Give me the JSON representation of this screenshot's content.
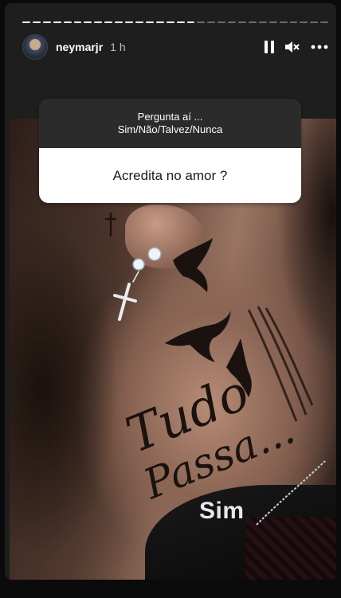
{
  "story": {
    "progress_segments": 30,
    "progress_done": 17,
    "username": "neymarjr",
    "time_ago": "1 h"
  },
  "controls": {
    "pause_icon": "pause-icon",
    "mute_icon": "speaker-muted-icon",
    "more_icon": "more-horizontal-icon"
  },
  "question_sticker": {
    "prompt_line1": "Pergunta aí ...",
    "prompt_line2": "Sim/Não/Talvez/Nunca",
    "question": "Acredita no amor ?"
  },
  "answer_text": "Sim",
  "tattoo_text_line1": "Tudo",
  "tattoo_text_line2": "Passa..."
}
